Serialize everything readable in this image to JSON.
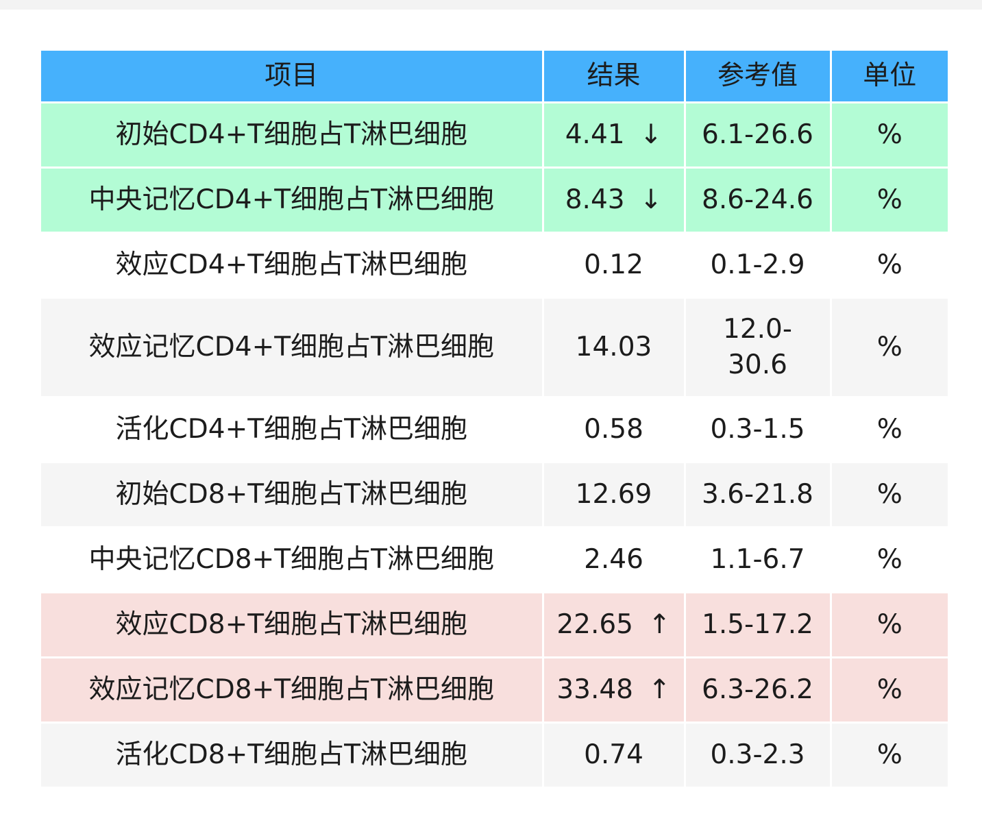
{
  "table": {
    "headers": [
      "项目",
      "结果",
      "参考值",
      "单位"
    ],
    "rows": [
      {
        "item": "初始CD4+T细胞占T淋巴细胞",
        "result": "4.41",
        "flag": "↓",
        "reference": "6.1-26.6",
        "unit": "%",
        "status": "low"
      },
      {
        "item": "中央记忆CD4+T细胞占T淋巴细胞",
        "result": "8.43",
        "flag": "↓",
        "reference": "8.6-24.6",
        "unit": "%",
        "status": "low"
      },
      {
        "item": "效应CD4+T细胞占T淋巴细胞",
        "result": "0.12",
        "flag": "",
        "reference": "0.1-2.9",
        "unit": "%",
        "status": "normal"
      },
      {
        "item": "效应记忆CD4+T细胞占T淋巴细胞",
        "result": "14.03",
        "flag": "",
        "reference": "12.0-30.6",
        "unit": "%",
        "status": "normal"
      },
      {
        "item": "活化CD4+T细胞占T淋巴细胞",
        "result": "0.58",
        "flag": "",
        "reference": "0.3-1.5",
        "unit": "%",
        "status": "normal"
      },
      {
        "item": "初始CD8+T细胞占T淋巴细胞",
        "result": "12.69",
        "flag": "",
        "reference": "3.6-21.8",
        "unit": "%",
        "status": "normal"
      },
      {
        "item": "中央记忆CD8+T细胞占T淋巴细胞",
        "result": "2.46",
        "flag": "",
        "reference": "1.1-6.7",
        "unit": "%",
        "status": "normal"
      },
      {
        "item": "效应CD8+T细胞占T淋巴细胞",
        "result": "22.65",
        "flag": "↑",
        "reference": "1.5-17.2",
        "unit": "%",
        "status": "high"
      },
      {
        "item": "效应记忆CD8+T细胞占T淋巴细胞",
        "result": "33.48",
        "flag": "↑",
        "reference": "6.3-26.2",
        "unit": "%",
        "status": "high"
      },
      {
        "item": "活化CD8+T细胞占T淋巴细胞",
        "result": "0.74",
        "flag": "",
        "reference": "0.3-2.3",
        "unit": "%",
        "status": "normal"
      }
    ]
  },
  "colors": {
    "header": "#46b1fc",
    "low": "#b3fcd5",
    "high": "#f8dfdd",
    "normal_alt": "#f5f5f5",
    "normal": "#ffffff"
  }
}
